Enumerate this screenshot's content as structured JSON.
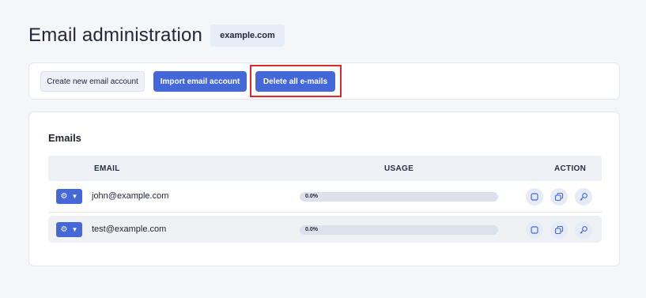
{
  "header": {
    "title": "Email administration",
    "domain": "example.com"
  },
  "toolbar": {
    "create_label": "Create new email account",
    "import_label": "Import email account",
    "delete_label": "Delete all e-mails"
  },
  "emails": {
    "title": "Emails",
    "columns": {
      "email": "EMAIL",
      "usage": "USAGE",
      "action": "ACTION"
    },
    "rows": [
      {
        "email": "john@example.com",
        "usage_text": "0.0%",
        "usage_fraction": 0.0
      },
      {
        "email": "test@example.com",
        "usage_text": "0.0%",
        "usage_fraction": 0.0
      }
    ]
  },
  "icons": {
    "row_menu": "gear-icon",
    "row_menu_caret": "caret-down-icon",
    "action_1": "square-icon",
    "action_2": "copy-icon",
    "action_3": "key-icon"
  },
  "colors": {
    "primary": "#4468d8",
    "highlight": "#e0282a",
    "background": "#f5f6fa"
  }
}
